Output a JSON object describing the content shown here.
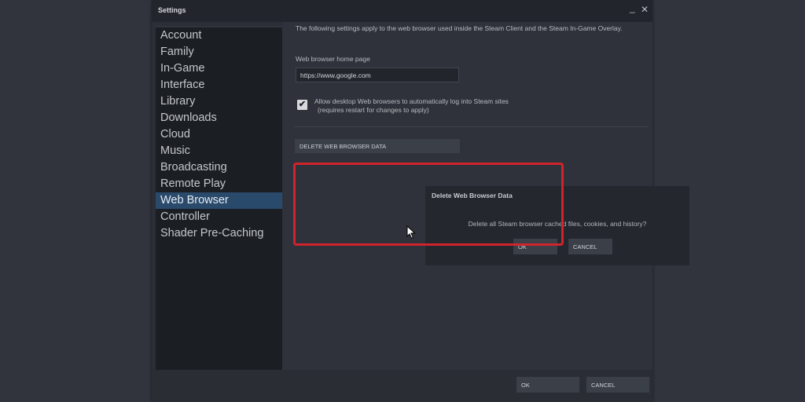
{
  "window": {
    "title": "Settings",
    "minimize_glyph": "_",
    "close_glyph": "✕"
  },
  "sidebar": {
    "items": [
      {
        "label": "Account"
      },
      {
        "label": "Family"
      },
      {
        "label": "In-Game"
      },
      {
        "label": "Interface"
      },
      {
        "label": "Library"
      },
      {
        "label": "Downloads"
      },
      {
        "label": "Cloud"
      },
      {
        "label": "Music"
      },
      {
        "label": "Broadcasting"
      },
      {
        "label": "Remote Play"
      },
      {
        "label": "Web Browser",
        "active": true
      },
      {
        "label": "Controller"
      },
      {
        "label": "Shader Pre-Caching"
      }
    ]
  },
  "web_browser": {
    "intro": "The following settings apply to the web browser used inside the Steam Client and the Steam In-Game Overlay.",
    "home_page_label": "Web browser home page",
    "home_page_value": "https://www.google.com",
    "auto_login_checked": true,
    "auto_login_label": "Allow desktop Web browsers to automatically log into Steam sites",
    "auto_login_note": "(requires restart for changes to apply)",
    "delete_button": "DELETE WEB BROWSER DATA"
  },
  "dialog": {
    "title": "Delete Web Browser Data",
    "message": "Delete all Steam browser cached files, cookies, and history?",
    "ok": "OK",
    "cancel": "CANCEL",
    "highlight_color": "#d0232b"
  },
  "footer": {
    "ok": "OK",
    "cancel": "CANCEL"
  },
  "icons": {
    "checkbox": "checkmark-icon",
    "cursor": "mouse-pointer-icon"
  }
}
